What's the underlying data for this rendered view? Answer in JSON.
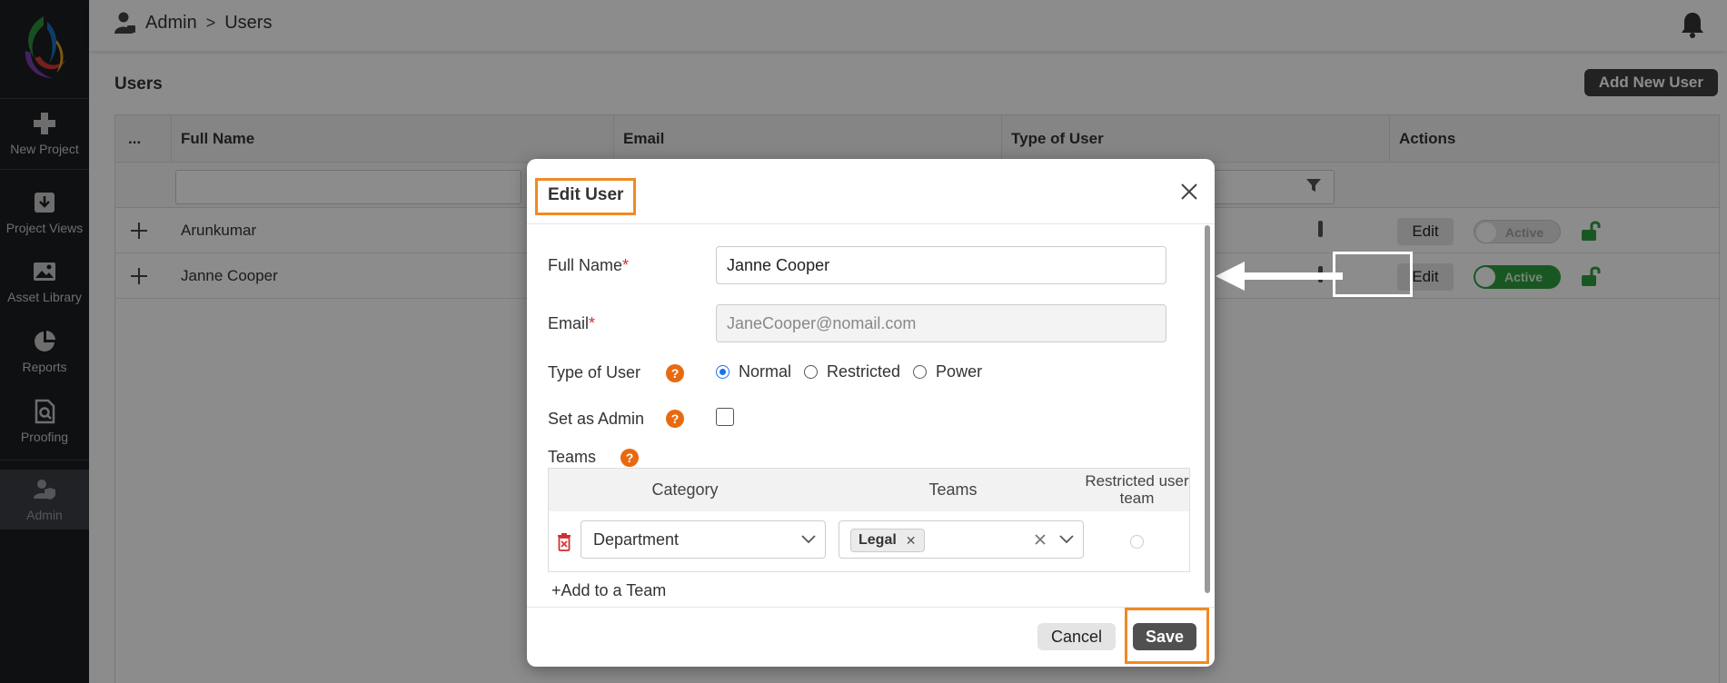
{
  "sidebar": {
    "items": [
      {
        "label": "New Project",
        "icon": "plus-icon"
      },
      {
        "label": "Project Views",
        "icon": "project-views-icon"
      },
      {
        "label": "Asset Library",
        "icon": "image-icon"
      },
      {
        "label": "Reports",
        "icon": "pie-chart-icon"
      },
      {
        "label": "Proofing",
        "icon": "proofing-icon"
      },
      {
        "label": "Admin",
        "icon": "admin-user-icon"
      }
    ]
  },
  "header": {
    "crumb_root": "Admin",
    "crumb_sep": ">",
    "crumb_current": "Users"
  },
  "page": {
    "title": "Users",
    "add_button": "Add New User"
  },
  "table": {
    "columns": {
      "menu": "...",
      "full_name": "Full Name",
      "email": "Email",
      "type": "Type of User",
      "actions": "Actions"
    },
    "rows": [
      {
        "name": "Arunkumar",
        "edit": "Edit",
        "status": "Active",
        "active": false
      },
      {
        "name": "Janne Cooper",
        "edit": "Edit",
        "status": "Active",
        "active": true
      }
    ]
  },
  "modal": {
    "title": "Edit User",
    "full_name_label": "Full Name",
    "full_name_value": "Janne Cooper",
    "email_label": "Email",
    "email_value": "JaneCooper@nomail.com",
    "required_mark": "*",
    "type_label": "Type of User",
    "help_glyph": "?",
    "type_options": [
      "Normal",
      "Restricted",
      "Power"
    ],
    "type_selected": "Normal",
    "admin_label": "Set as Admin",
    "teams_label": "Teams",
    "teams_table": {
      "col_category": "Category",
      "col_teams": "Teams",
      "col_restricted": "Restricted user team",
      "category_value": "Department",
      "team_chip": "Legal"
    },
    "add_team": "+Add to a Team",
    "cancel": "Cancel",
    "save": "Save"
  },
  "colors": {
    "sidebar_bg": "#1c1e22",
    "highlight": "#f08a24",
    "active_toggle": "#2e9e3f",
    "help_icon": "#e86a10",
    "lock_icon": "#2e9e3f"
  }
}
